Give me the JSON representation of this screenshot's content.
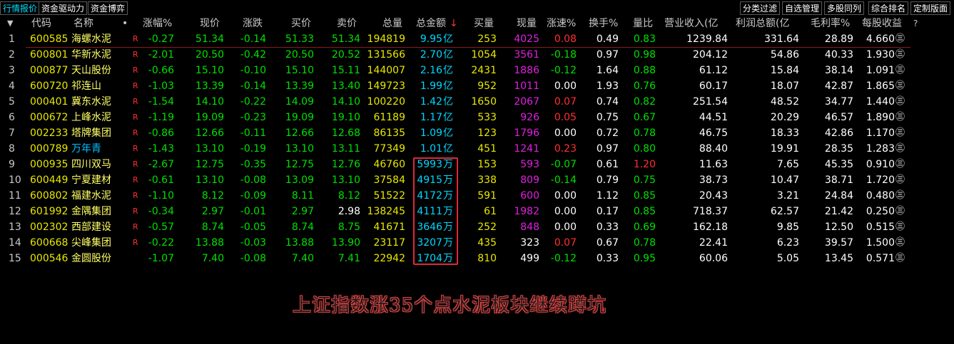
{
  "tabs_left": [
    "行情报价",
    "资金驱动力",
    "资金博弈"
  ],
  "tabs_right": [
    "分类过滤",
    "自选管理",
    "多股同列",
    "综合排名",
    "定制版面"
  ],
  "columns": {
    "arrow": "▼",
    "code": "代码",
    "name": "名称",
    "dot": "•",
    "pct": "涨幅%",
    "price": "现价",
    "chg": "涨跌",
    "bid": "买价",
    "ask": "卖价",
    "vol": "总量",
    "amount": "总金额",
    "sort_icon": "↓",
    "buy_vol": "买量",
    "cur_vol": "现量",
    "speed": "涨速%",
    "turnover": "换手%",
    "vol_ratio": "量比",
    "revenue": "营业收入(亿",
    "profit": "利润总额(亿",
    "margin": "毛利率%",
    "eps": "每股收益",
    "q": "?"
  },
  "colors": {
    "up": "#ff3030",
    "down": "#00e000",
    "flat": "#ffffff",
    "code": "#e8e800",
    "name": "#ffff66",
    "amount": "#00d8ff",
    "curvol_up": "#e020e0",
    "separator": "#8b1a1a",
    "highlight_box": "#e0283c"
  },
  "rows": [
    {
      "no": "1",
      "code": "600585",
      "name": "海螺水泥",
      "flag": "R",
      "pct": "-0.27",
      "price": "51.34",
      "chg": "-0.14",
      "bid": "51.33",
      "ask": "51.34",
      "vol": "194819",
      "amount": "9.95",
      "unit": "亿",
      "buy_vol": "253",
      "cur_vol": "4025",
      "speed": "0.08",
      "turnover": "0.49",
      "vol_ratio": "0.83",
      "revenue": "1239.84",
      "profit": "331.64",
      "margin": "28.89",
      "eps": "4.660"
    },
    {
      "no": "2",
      "code": "600801",
      "name": "华新水泥",
      "flag": "R",
      "pct": "-2.01",
      "price": "20.50",
      "chg": "-0.42",
      "bid": "20.50",
      "ask": "20.52",
      "vol": "131566",
      "amount": "2.70",
      "unit": "亿",
      "buy_vol": "1054",
      "cur_vol": "3561",
      "speed": "-0.18",
      "turnover": "0.97",
      "vol_ratio": "0.98",
      "revenue": "204.12",
      "profit": "54.86",
      "margin": "40.33",
      "eps": "1.930"
    },
    {
      "no": "3",
      "code": "000877",
      "name": "天山股份",
      "flag": "R",
      "pct": "-0.66",
      "price": "15.10",
      "chg": "-0.10",
      "bid": "15.10",
      "ask": "15.11",
      "vol": "144007",
      "amount": "2.16",
      "unit": "亿",
      "buy_vol": "2431",
      "cur_vol": "1886",
      "speed": "-0.12",
      "turnover": "1.64",
      "vol_ratio": "0.88",
      "revenue": "61.12",
      "profit": "15.84",
      "margin": "38.14",
      "eps": "1.091"
    },
    {
      "no": "4",
      "code": "600720",
      "name": "祁连山",
      "flag": "R",
      "pct": "-1.03",
      "price": "13.39",
      "chg": "-0.14",
      "bid": "13.39",
      "ask": "13.40",
      "vol": "149723",
      "amount": "1.99",
      "unit": "亿",
      "buy_vol": "952",
      "cur_vol": "1011",
      "speed": "0.00",
      "turnover": "1.93",
      "vol_ratio": "0.76",
      "revenue": "60.17",
      "profit": "18.07",
      "margin": "42.87",
      "eps": "1.865"
    },
    {
      "no": "5",
      "code": "000401",
      "name": "冀东水泥",
      "flag": "R",
      "pct": "-1.54",
      "price": "14.10",
      "chg": "-0.22",
      "bid": "14.09",
      "ask": "14.10",
      "vol": "100220",
      "amount": "1.42",
      "unit": "亿",
      "buy_vol": "1650",
      "cur_vol": "2067",
      "speed": "0.07",
      "turnover": "0.74",
      "vol_ratio": "0.82",
      "revenue": "251.54",
      "profit": "48.52",
      "margin": "34.77",
      "eps": "1.440"
    },
    {
      "no": "6",
      "code": "000672",
      "name": "上峰水泥",
      "flag": "R",
      "pct": "-1.19",
      "price": "19.09",
      "chg": "-0.23",
      "bid": "19.09",
      "ask": "19.10",
      "vol": "61189",
      "amount": "1.17",
      "unit": "亿",
      "buy_vol": "533",
      "cur_vol": "926",
      "speed": "0.05",
      "turnover": "0.75",
      "vol_ratio": "0.67",
      "revenue": "44.51",
      "profit": "20.29",
      "margin": "46.57",
      "eps": "1.890"
    },
    {
      "no": "7",
      "code": "002233",
      "name": "塔牌集团",
      "flag": "R",
      "pct": "-0.86",
      "price": "12.66",
      "chg": "-0.11",
      "bid": "12.66",
      "ask": "12.68",
      "vol": "86135",
      "amount": "1.09",
      "unit": "亿",
      "buy_vol": "123",
      "cur_vol": "1796",
      "speed": "0.00",
      "turnover": "0.72",
      "vol_ratio": "0.78",
      "revenue": "46.75",
      "profit": "18.33",
      "margin": "42.86",
      "eps": "1.170"
    },
    {
      "no": "8",
      "code": "000789",
      "name": "万年青",
      "flag": "R",
      "pct": "-1.43",
      "price": "13.10",
      "chg": "-0.19",
      "bid": "13.10",
      "ask": "13.11",
      "vol": "77349",
      "amount": "1.01",
      "unit": "亿",
      "buy_vol": "451",
      "cur_vol": "1241",
      "speed": "0.23",
      "turnover": "0.97",
      "vol_ratio": "0.80",
      "revenue": "88.40",
      "profit": "19.91",
      "margin": "28.35",
      "eps": "1.283"
    },
    {
      "no": "9",
      "code": "000935",
      "name": "四川双马",
      "flag": "R",
      "pct": "-2.67",
      "price": "12.75",
      "chg": "-0.35",
      "bid": "12.75",
      "ask": "12.76",
      "vol": "46760",
      "amount": "5993",
      "unit": "万",
      "buy_vol": "153",
      "cur_vol": "593",
      "speed": "-0.07",
      "turnover": "0.61",
      "vol_ratio": "1.20",
      "revenue": "11.63",
      "profit": "7.65",
      "margin": "45.35",
      "eps": "0.910"
    },
    {
      "no": "10",
      "code": "600449",
      "name": "宁夏建材",
      "flag": "R",
      "pct": "-0.61",
      "price": "13.10",
      "chg": "-0.08",
      "bid": "13.09",
      "ask": "13.10",
      "vol": "37584",
      "amount": "4915",
      "unit": "万",
      "buy_vol": "338",
      "cur_vol": "809",
      "speed": "-0.14",
      "turnover": "0.79",
      "vol_ratio": "0.75",
      "revenue": "38.73",
      "profit": "10.47",
      "margin": "38.71",
      "eps": "1.720"
    },
    {
      "no": "11",
      "code": "600802",
      "name": "福建水泥",
      "flag": "R",
      "pct": "-1.10",
      "price": "8.12",
      "chg": "-0.09",
      "bid": "8.11",
      "ask": "8.12",
      "vol": "51522",
      "amount": "4172",
      "unit": "万",
      "buy_vol": "591",
      "cur_vol": "600",
      "speed": "0.00",
      "turnover": "1.12",
      "vol_ratio": "0.85",
      "revenue": "20.43",
      "profit": "3.21",
      "margin": "24.84",
      "eps": "0.480"
    },
    {
      "no": "12",
      "code": "601992",
      "name": "金隅集团",
      "flag": "R",
      "pct": "-0.34",
      "price": "2.97",
      "chg": "-0.01",
      "bid": "2.97",
      "ask": "2.98",
      "vol": "138245",
      "amount": "4111",
      "unit": "万",
      "buy_vol": "61",
      "cur_vol": "1982",
      "speed": "0.00",
      "turnover": "0.17",
      "vol_ratio": "0.85",
      "revenue": "718.37",
      "profit": "62.57",
      "margin": "21.42",
      "eps": "0.250"
    },
    {
      "no": "13",
      "code": "002302",
      "name": "西部建设",
      "flag": "R",
      "pct": "-0.57",
      "price": "8.74",
      "chg": "-0.05",
      "bid": "8.74",
      "ask": "8.75",
      "vol": "41671",
      "amount": "3646",
      "unit": "万",
      "buy_vol": "252",
      "cur_vol": "848",
      "speed": "0.00",
      "turnover": "0.33",
      "vol_ratio": "0.69",
      "revenue": "162.18",
      "profit": "9.85",
      "margin": "12.50",
      "eps": "0.515"
    },
    {
      "no": "14",
      "code": "600668",
      "name": "尖峰集团",
      "flag": "R",
      "pct": "-0.22",
      "price": "13.88",
      "chg": "-0.03",
      "bid": "13.88",
      "ask": "13.90",
      "vol": "23117",
      "amount": "3207",
      "unit": "万",
      "buy_vol": "435",
      "cur_vol": "323",
      "speed": "0.07",
      "turnover": "0.67",
      "vol_ratio": "0.78",
      "revenue": "22.41",
      "profit": "6.23",
      "margin": "39.57",
      "eps": "1.500"
    },
    {
      "no": "15",
      "code": "000546",
      "name": "金圆股份",
      "flag": "",
      "pct": "-1.07",
      "price": "7.40",
      "chg": "-0.08",
      "bid": "7.40",
      "ask": "7.41",
      "vol": "22942",
      "amount": "1704",
      "unit": "万",
      "buy_vol": "810",
      "cur_vol": "499",
      "speed": "-0.12",
      "turnover": "0.33",
      "vol_ratio": "0.95",
      "revenue": "60.06",
      "profit": "5.05",
      "margin": "13.45",
      "eps": "0.571"
    }
  ],
  "eps_icon": "㊂",
  "caption": "上证指数涨35个点水泥板块继续蹲坑"
}
